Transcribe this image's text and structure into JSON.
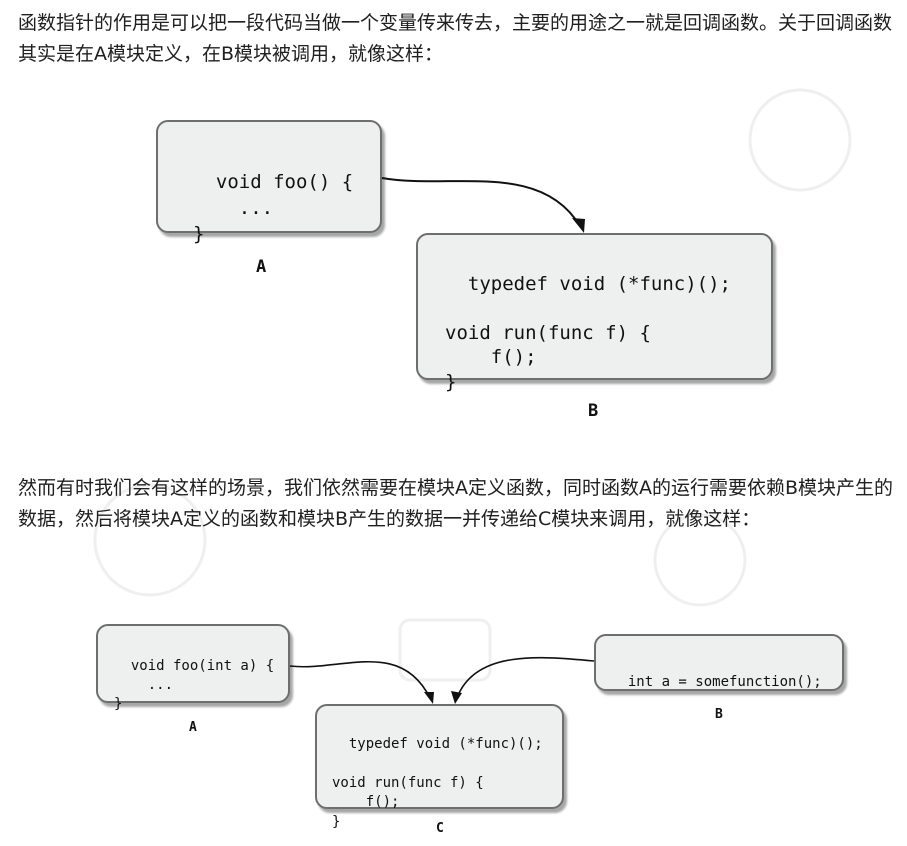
{
  "intro_paragraph": "函数指针的作用是可以把一段代码当做一个变量传来传去，主要的用途之一就是回调函数。关于回调函数其实是在A模块定义，在B模块被调用，就像这样：",
  "second_paragraph": "然而有时我们会有这样的场景，我们依然需要在模块A定义函数，同时函数A的运行需要依赖B模块产生的数据，然后将模块A定义的函数和模块B产生的数据一并传递给C模块来调用，就像这样：",
  "diagram1": {
    "box_a_code": "void foo() {\n    ...\n}",
    "box_b_code": "typedef void (*func)();\n\nvoid run(func f) {\n    f();\n}",
    "label_a": "A",
    "label_b": "B"
  },
  "diagram2": {
    "box_a_code": "void foo(int a) {\n    ...\n}",
    "box_b_code": "int a = somefunction();",
    "box_c_code": "typedef void (*func)();\n\nvoid run(func f) {\n    f();\n}",
    "label_a": "A",
    "label_b": "B",
    "label_c": "C"
  },
  "colors": {
    "box_fill": "#eeefef",
    "box_border": "#6c6e70",
    "arrow": "#111111",
    "text": "#202020"
  }
}
